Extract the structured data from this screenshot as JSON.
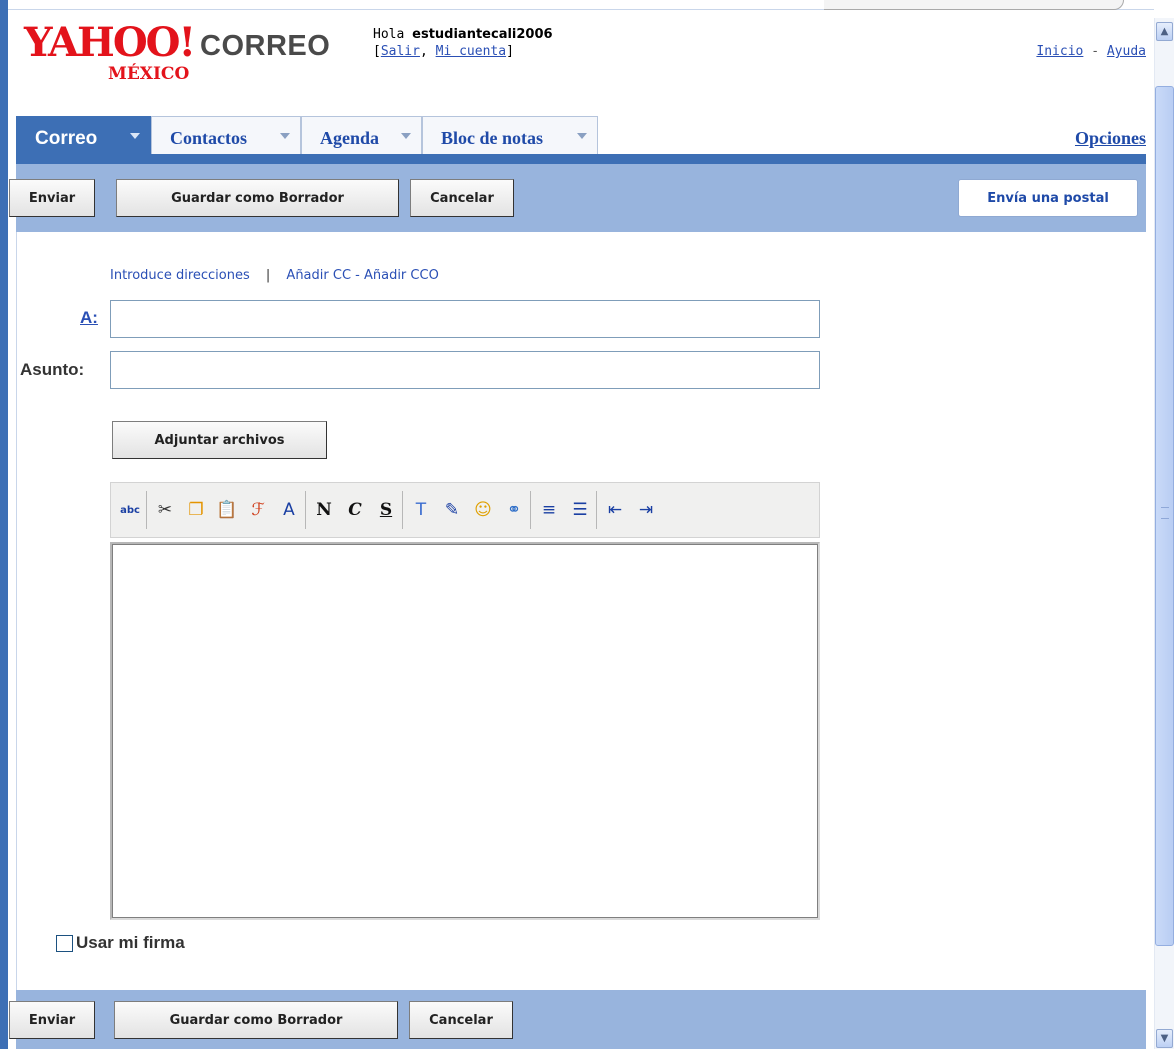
{
  "header": {
    "logo_text": "YAHOO!",
    "logo_region": "MÉXICO",
    "product": "CORREO",
    "greeting": "Hola",
    "username": "estudiantecali2006",
    "salir": "Salir",
    "mi_cuenta": "Mi cuenta",
    "inicio": "Inicio",
    "ayuda": "Ayuda",
    "link_separator": "-"
  },
  "tabs": [
    {
      "label": "Correo",
      "active": true
    },
    {
      "label": "Contactos",
      "active": false
    },
    {
      "label": "Agenda",
      "active": false
    },
    {
      "label": "Bloc de notas",
      "active": false
    }
  ],
  "opciones": "Opciones",
  "toolbar": {
    "send": "Enviar",
    "save_draft": "Guardar como Borrador",
    "cancel": "Cancelar",
    "postal": "Envía una postal"
  },
  "compose": {
    "introduce": "Introduce direcciones",
    "divider": "|",
    "add_cc": "Añadir CC - Añadir CCO",
    "to_label": "A:",
    "to_value": "",
    "subject_label": "Asunto:",
    "subject_value": "",
    "attach": "Adjuntar archivos",
    "body": "",
    "signature_label": "Usar mi firma",
    "signature_checked": false
  },
  "editor_toolbar": [
    {
      "name": "spellcheck-icon",
      "glyph": "abc",
      "color": "#1a3fa3"
    },
    {
      "name": "cut-icon",
      "glyph": "✂",
      "color": "#333333"
    },
    {
      "name": "copy-icon",
      "glyph": "❐",
      "color": "#e49400"
    },
    {
      "name": "paste-icon",
      "glyph": "📋",
      "color": "#a07a2a"
    },
    {
      "name": "font-icon",
      "glyph": "ℱ",
      "color": "#d0401d"
    },
    {
      "name": "font-size-icon",
      "glyph": "A",
      "color": "#1a3fa3"
    },
    {
      "name": "bold-icon",
      "glyph": "N",
      "color": "#111111"
    },
    {
      "name": "italic-icon",
      "glyph": "C",
      "color": "#111111"
    },
    {
      "name": "underline-icon",
      "glyph": "S",
      "color": "#111111"
    },
    {
      "name": "text-color-icon",
      "glyph": "T",
      "color": "#3a6ccf"
    },
    {
      "name": "highlight-icon",
      "glyph": "✎",
      "color": "#1a3fa3"
    },
    {
      "name": "emoticon-icon",
      "glyph": "☺",
      "color": "#e0a000"
    },
    {
      "name": "link-icon",
      "glyph": "⚭",
      "color": "#2e6ec8"
    },
    {
      "name": "align-icon",
      "glyph": "≡",
      "color": "#1a3fa3"
    },
    {
      "name": "list-icon",
      "glyph": "☰",
      "color": "#1a3fa3"
    },
    {
      "name": "outdent-icon",
      "glyph": "⇤",
      "color": "#1a3fa3"
    },
    {
      "name": "indent-icon",
      "glyph": "⇥",
      "color": "#1a3fa3"
    }
  ],
  "colors": {
    "brand_red": "#e3131b",
    "tab_blue": "#3d6fb5",
    "toolbar_blue": "#98b4dd",
    "link_blue": "#2a4fb5"
  }
}
